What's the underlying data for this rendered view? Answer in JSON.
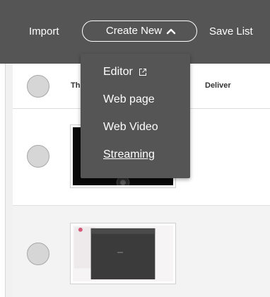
{
  "toolbar": {
    "import_label": "Import",
    "create_label": "Create New",
    "save_label": "Save List"
  },
  "table": {
    "headers": [
      "Th",
      "Deliver"
    ]
  },
  "menu": {
    "items": [
      {
        "label": "Editor",
        "icon": "external-link-icon"
      },
      {
        "label": "Web page"
      },
      {
        "label": "Web Video"
      },
      {
        "label": "Streaming"
      }
    ]
  },
  "colors": {
    "toolbar_bg": "#555555",
    "menu_bg": "#555555",
    "text_on_dark": "#ffffff"
  }
}
